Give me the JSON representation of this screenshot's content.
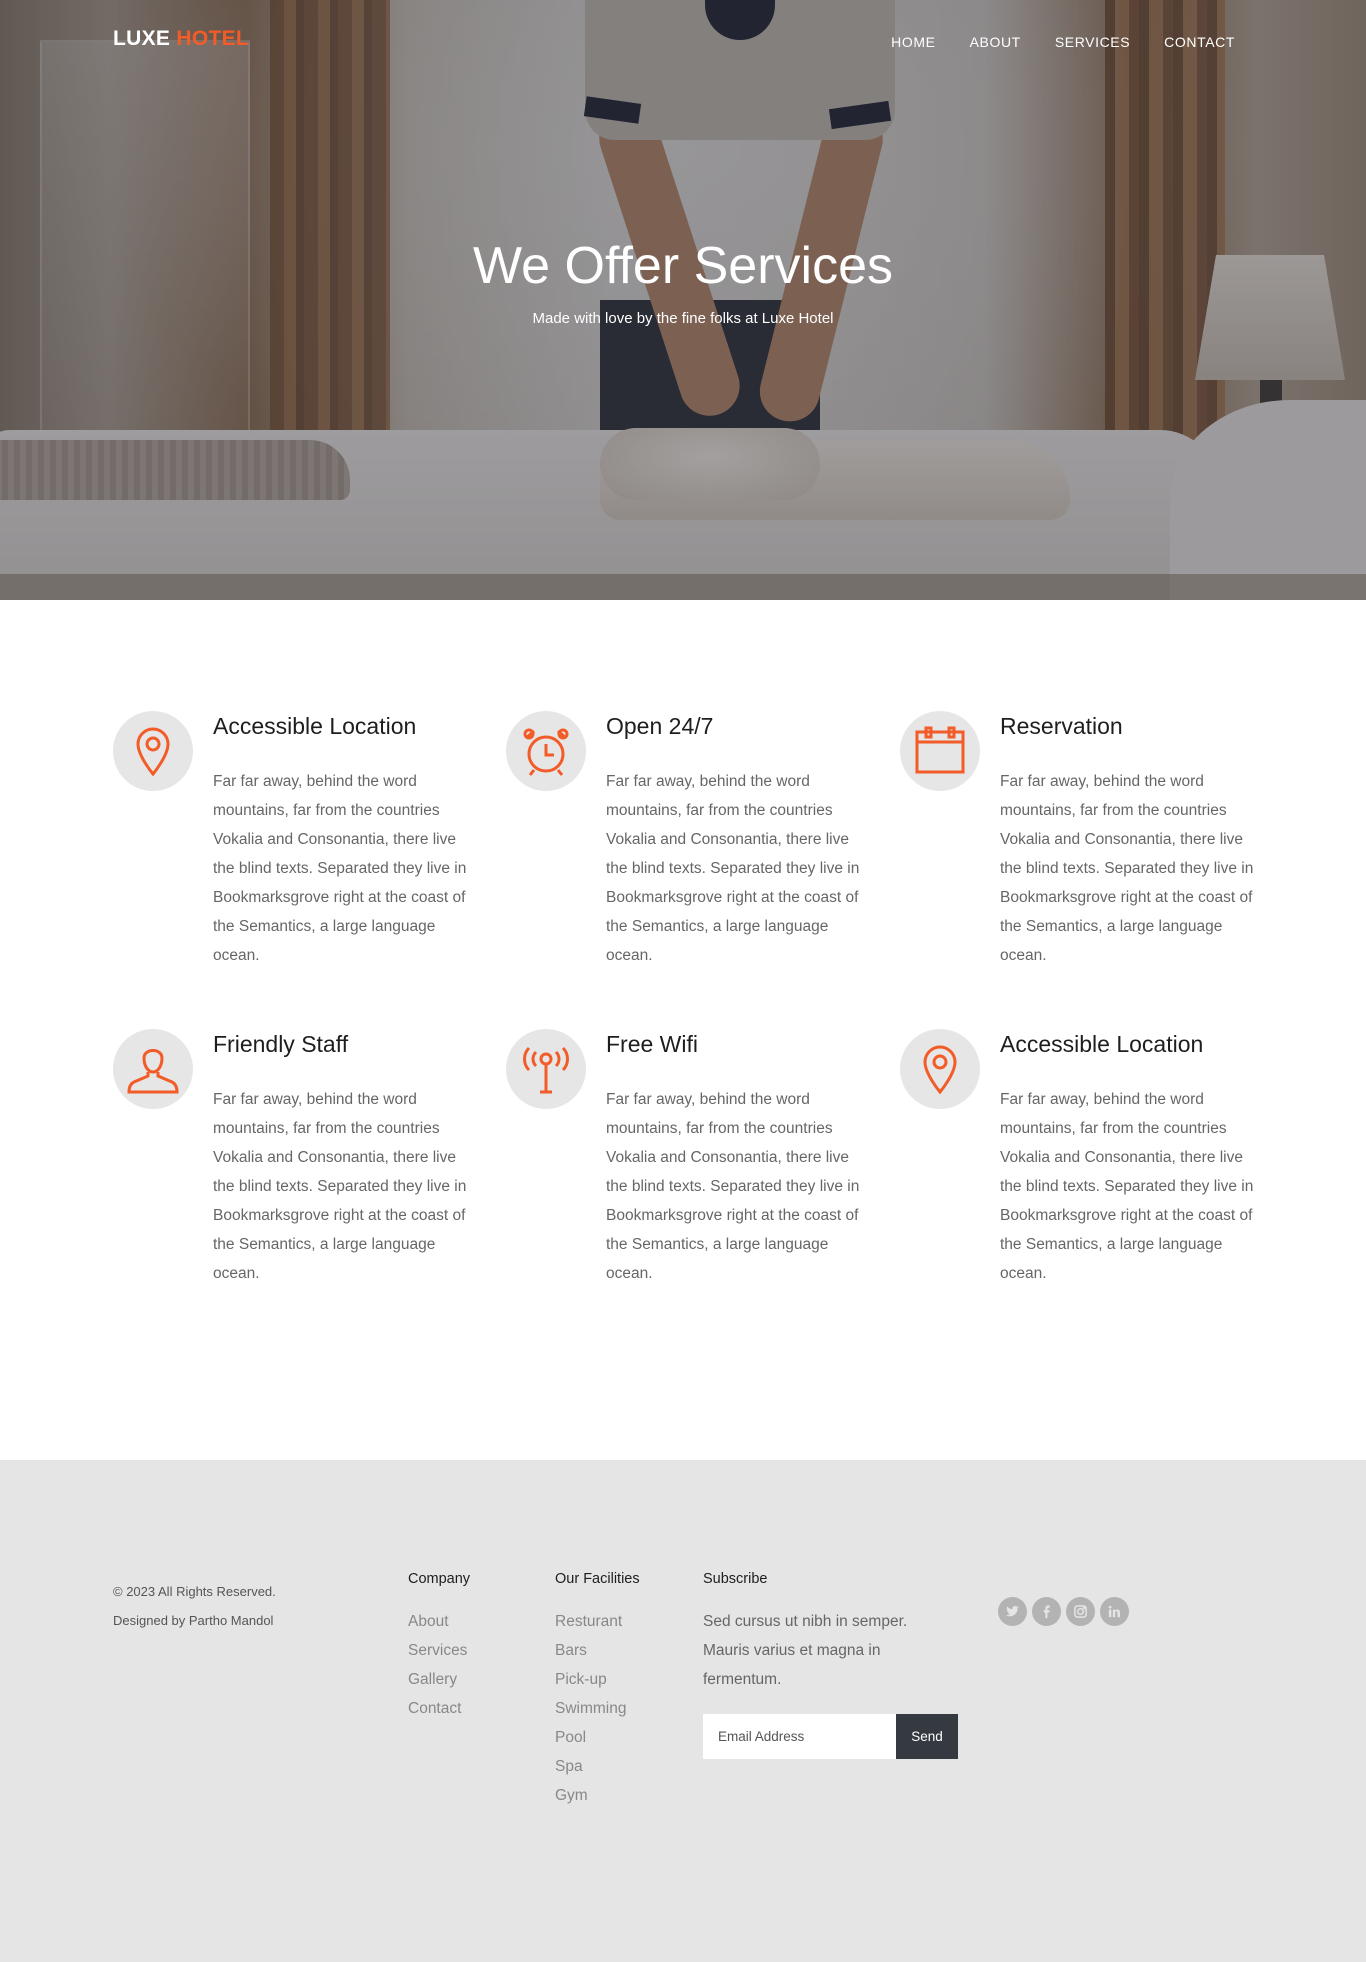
{
  "brand": {
    "part1": "LUXE",
    "part2": "HOTEL",
    "accent_color": "#f25c28"
  },
  "nav": [
    "HOME",
    "ABOUT",
    "SERVICES",
    "CONTACT"
  ],
  "hero": {
    "title": "We Offer Services",
    "subtitle": "Made with love by the fine folks at Luxe Hotel"
  },
  "services": [
    {
      "title": "Accessible Location",
      "icon": "location-pin-icon",
      "text": "Far far away, behind the word mountains, far from the countries Vokalia and Consonantia, there live the blind texts. Separated they live in Bookmarksgrove right at the coast of the Semantics, a large language ocean."
    },
    {
      "title": "Open 24/7",
      "icon": "alarm-clock-icon",
      "text": "Far far away, behind the word mountains, far from the countries Vokalia and Consonantia, there live the blind texts. Separated they live in Bookmarksgrove right at the coast of the Semantics, a large language ocean."
    },
    {
      "title": "Reservation",
      "icon": "calendar-icon",
      "text": "Far far away, behind the word mountains, far from the countries Vokalia and Consonantia, there live the blind texts. Separated they live in Bookmarksgrove right at the coast of the Semantics, a large language ocean."
    },
    {
      "title": "Friendly Staff",
      "icon": "person-icon",
      "text": "Far far away, behind the word mountains, far from the countries Vokalia and Consonantia, there live the blind texts. Separated they live in Bookmarksgrove right at the coast of the Semantics, a large language ocean."
    },
    {
      "title": "Free Wifi",
      "icon": "antenna-icon",
      "text": "Far far away, behind the word mountains, far from the countries Vokalia and Consonantia, there live the blind texts. Separated they live in Bookmarksgrove right at the coast of the Semantics, a large language ocean."
    },
    {
      "title": "Accessible Location",
      "icon": "location-pin-icon",
      "text": "Far far away, behind the word mountains, far from the countries Vokalia and Consonantia, there live the blind texts. Separated they live in Bookmarksgrove right at the coast of the Semantics, a large language ocean."
    }
  ],
  "footer": {
    "copyright": "© 2023 All Rights Reserved.",
    "designer": "Designed by Partho Mandol",
    "company": {
      "heading": "Company",
      "links": [
        "About",
        "Services",
        "Gallery",
        "Contact"
      ]
    },
    "facilities": {
      "heading": "Our Facilities",
      "links": [
        "Resturant",
        "Bars",
        "Pick-up",
        "Swimming",
        "Pool",
        "Spa",
        "Gym"
      ]
    },
    "subscribe": {
      "heading": "Subscribe",
      "text": "Sed cursus ut nibh in semper. Mauris varius et magna in fermentum.",
      "placeholder": "Email Address",
      "button": "Send"
    },
    "social": [
      "twitter-icon",
      "facebook-icon",
      "instagram-icon",
      "linkedin-icon"
    ]
  }
}
